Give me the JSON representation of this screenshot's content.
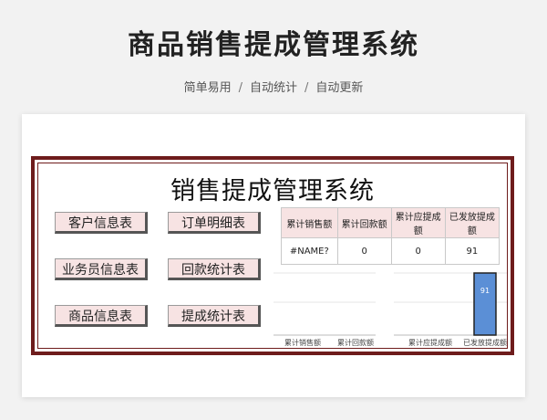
{
  "header": {
    "title": "商品销售提成管理系统",
    "subtitle_items": [
      "简单易用",
      "自动统计",
      "自动更新"
    ],
    "separator": "/"
  },
  "sheet": {
    "title": "销售提成管理系统",
    "frame_color": "#6e1c1c",
    "buttons": {
      "customer": "客户信息表",
      "orders": "订单明细表",
      "salesperson": "业务员信息表",
      "payments": "回款统计表",
      "products": "商品信息表",
      "commission": "提成统计表"
    },
    "summary": {
      "headers": [
        "累计销售额",
        "累计回款额",
        "累计应提成额",
        "已发放提成额"
      ],
      "values": [
        "#NAME?",
        "0",
        "0",
        "91"
      ]
    }
  },
  "chart_data": {
    "type": "bar",
    "categories": [
      "累计销售额",
      "累计回款额",
      "累计应提成额",
      "已发放提成额"
    ],
    "values": [
      0,
      0,
      0,
      91
    ],
    "data_labels": [
      "",
      "",
      "",
      "91"
    ],
    "bar_color": "#5b8fd6"
  }
}
